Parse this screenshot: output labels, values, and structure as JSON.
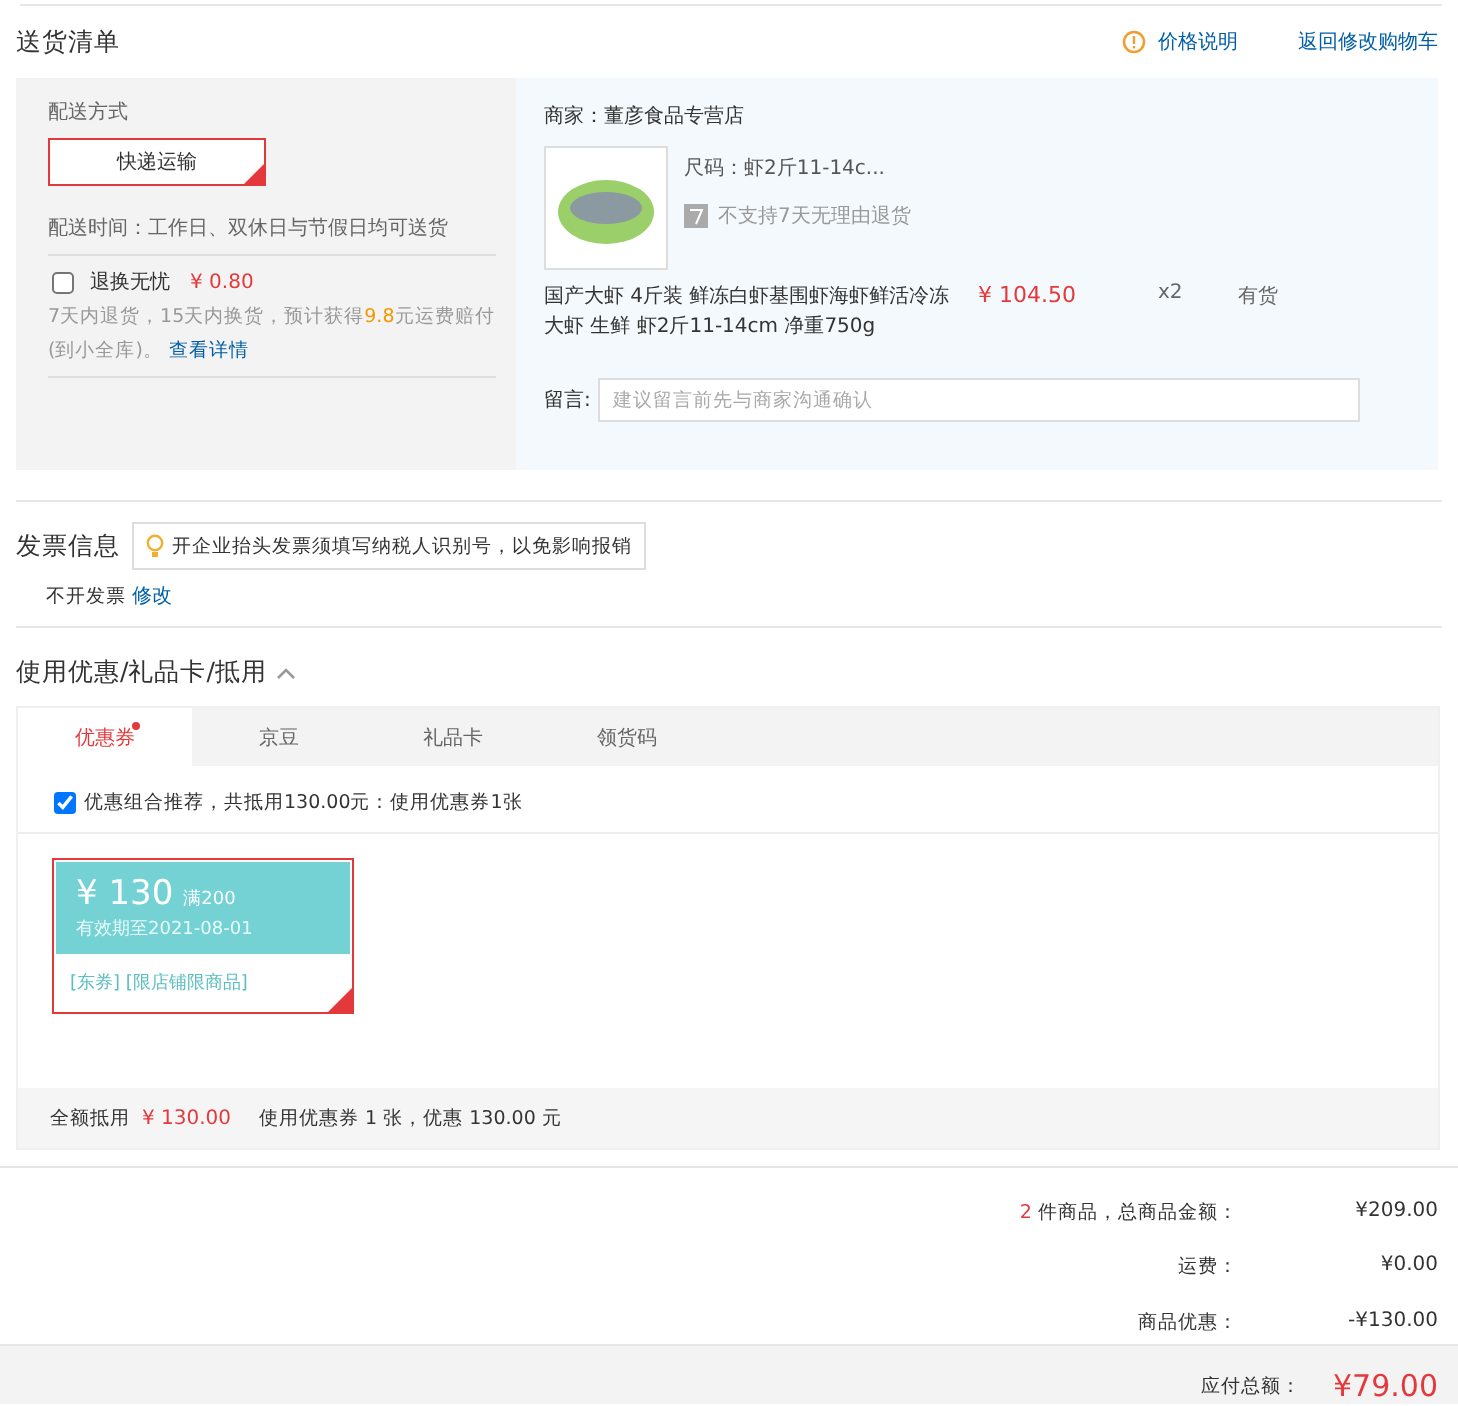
{
  "delivery_list": {
    "title": "送货清单",
    "price_note": "价格说明",
    "back_link": "返回修改购物车",
    "shipping": {
      "label": "配送方式",
      "options": [
        {
          "label": "快递运输",
          "selected": true
        }
      ],
      "time": "配送时间：工作日、双休日与节假日均可送货",
      "insurance": {
        "label": "退换无忧",
        "price": "¥ 0.80",
        "checked": false,
        "desc_before": "7天内退货，15天内换货，预计获得",
        "desc_amount": "9.8",
        "desc_after": "元运费赔付(到小全库)。",
        "details_link": "查看详情"
      }
    },
    "shop": {
      "label": "商家：",
      "name": "董彦食品专营店",
      "size": "尺码：虾2斤11-14c...",
      "no_return": "不支持7天无理由退货",
      "product_name": "国产大虾 4斤装 鲜冻白虾基围虾海虾鲜活冷冻大虾 生鲜 虾2斤11-14cm 净重750g",
      "price": "¥ 104.50",
      "quantity": "x2",
      "stock": "有货",
      "message_label": "留言:",
      "message_placeholder": "建议留言前先与商家沟通确认"
    }
  },
  "invoice": {
    "title": "发票信息",
    "tip": "开企业抬头发票须填写纳税人识别号，以免影响报销",
    "value": "不开发票",
    "edit_link": "修改"
  },
  "discounts": {
    "title": "使用优惠/礼品卡/抵用",
    "expanded": true,
    "tabs": [
      {
        "label": "优惠券",
        "selected": true,
        "dot": true
      },
      {
        "label": "京豆",
        "selected": false,
        "dot": false
      },
      {
        "label": "礼品卡",
        "selected": false,
        "dot": false
      },
      {
        "label": "领货码",
        "selected": false,
        "dot": false
      }
    ],
    "recommend": {
      "checked": true,
      "label": "优惠组合推荐，共抵用130.00元：使用优惠券1张"
    },
    "coupons": [
      {
        "amount": "¥ 130",
        "condition": "满200",
        "expiry": "有效期至2021-08-01",
        "tags": "[东券] [限店铺限商品]",
        "selected": true
      }
    ],
    "footer": {
      "label": "全额抵用",
      "amount": "¥ 130.00",
      "summary": "使用优惠券 1 张，优惠 130.00 元"
    }
  },
  "summary": {
    "rows": [
      {
        "count": "2",
        "label": " 件商品，总商品金额：",
        "value": "¥209.00"
      },
      {
        "count": "",
        "label": "运费：",
        "value": "¥0.00"
      },
      {
        "count": "",
        "label": "商品优惠：",
        "value": "-¥130.00"
      }
    ],
    "total_label": "应付总额：",
    "total": "¥79.00"
  }
}
